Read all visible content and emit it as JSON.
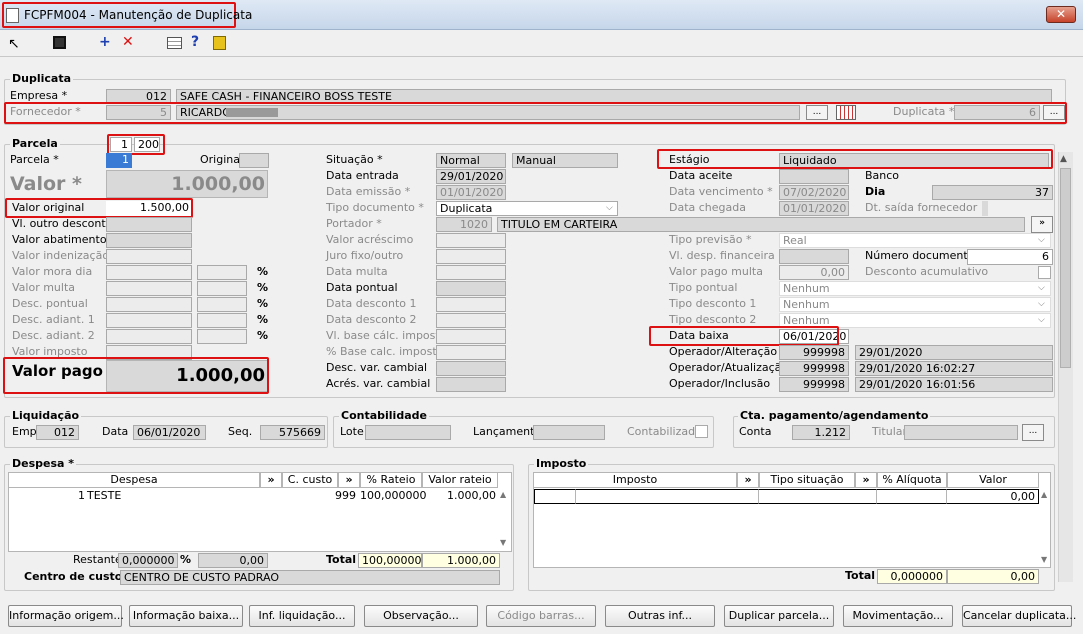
{
  "window": {
    "title": "FCPFM004 - Manutenção de Duplicata"
  },
  "toolbar": {
    "plus": "+",
    "times": "✕",
    "help": "?"
  },
  "duplicata": {
    "section": "Duplicata",
    "empresa_label": "Empresa *",
    "empresa_code": "012",
    "empresa_name": "SAFE CASH - FINANCEIRO BOSS TESTE",
    "fornecedor_label": "Fornecedor *",
    "fornecedor_code": "5",
    "fornecedor_name": "RICARDO",
    "duplicata_label": "Duplicata *",
    "duplicata_value": "6"
  },
  "parcela": {
    "section": "Parcela",
    "num": "1",
    "total": "200",
    "parcela_label": "Parcela *",
    "parcela_value": "1",
    "original_label": "Original",
    "valor_label": "Valor *",
    "valor_value": "1.000,00",
    "fields": [
      {
        "label": "Valor original",
        "value": "1.500,00"
      },
      {
        "label": "Vl. outro desconto",
        "value": ""
      },
      {
        "label": "Valor abatimento",
        "value": ""
      },
      {
        "label": "Valor indenização",
        "value": ""
      },
      {
        "label": "Valor mora dia",
        "value": ""
      },
      {
        "label": "Valor multa",
        "value": ""
      },
      {
        "label": "Desc. pontual",
        "value": ""
      },
      {
        "label": "Desc. adiant. 1",
        "value": ""
      },
      {
        "label": "Desc. adiant. 2",
        "value": ""
      },
      {
        "label": "Valor imposto",
        "value": ""
      }
    ],
    "percent": "%",
    "valor_pago_label": "Valor pago",
    "valor_pago_value": "1.000,00"
  },
  "mid": {
    "situacao_label": "Situação *",
    "situacao_1": "Normal",
    "situacao_2": "Manual",
    "data_entrada_label": "Data entrada",
    "data_entrada": "29/01/2020",
    "data_emissao_label": "Data emissão *",
    "data_emissao": "01/01/2020",
    "tipo_doc_label": "Tipo documento *",
    "tipo_doc": "Duplicata",
    "portador_label": "Portador *",
    "portador_code": "1020",
    "portador_name": "TITULO EM CARTEIRA",
    "labels": [
      "Valor acréscimo",
      "Juro fixo/outro",
      "Data multa",
      "Data pontual",
      "Data desconto 1",
      "Data desconto 2",
      "Vl. base cálc. imposto",
      "% Base calc. imposto",
      "Desc. var. cambial",
      "Acrés. var. cambial"
    ]
  },
  "right": {
    "estagio_label": "Estágio",
    "estagio_value": "Liquidado",
    "data_aceite_label": "Data aceite",
    "banco_label": "Banco",
    "data_vencimento_label": "Data vencimento *",
    "data_vencimento": "07/02/2020",
    "dia_label": "Dia",
    "dia_value": "37",
    "data_chegada_label": "Data chegada",
    "data_chegada": "01/01/2020",
    "dt_saida_label": "Dt. saída fornecedor",
    "tipo_previsao_label": "Tipo previsão *",
    "tipo_previsao": "Real",
    "vl_desp_label": "Vl. desp. financeira",
    "num_doc_label": "Número documento",
    "num_doc": "6",
    "vl_pago_multa_label": "Valor pago multa",
    "vl_pago_multa": "0,00",
    "desc_acum_label": "Desconto acumulativo",
    "tipo_pontual_label": "Tipo pontual",
    "tipo_pontual": "Nenhum",
    "tipo_desc1_label": "Tipo desconto 1",
    "tipo_desc1": "Nenhum",
    "tipo_desc2_label": "Tipo desconto 2",
    "tipo_desc2": "Nenhum",
    "data_baixa_label": "Data baixa",
    "data_baixa": "06/01/2020",
    "operadores": [
      {
        "label": "Operador/Alteração",
        "code": "999998",
        "date": "29/01/2020"
      },
      {
        "label": "Operador/Atualização",
        "code": "999998",
        "date": "29/01/2020 16:02:27"
      },
      {
        "label": "Operador/Inclusão",
        "code": "999998",
        "date": "29/01/2020 16:01:56"
      }
    ]
  },
  "liquidacao": {
    "section": "Liquidação",
    "emp_label": "Emp.",
    "emp": "012",
    "data_label": "Data",
    "data": "06/01/2020",
    "seq_label": "Seq.",
    "seq": "575669"
  },
  "contabilidade": {
    "section": "Contabilidade",
    "lote_label": "Lote",
    "lancamento_label": "Lançamento",
    "contabilizado_label": "Contabilizado"
  },
  "cta": {
    "section": "Cta. pagamento/agendamento",
    "conta_label": "Conta",
    "conta": "1.212",
    "titular_label": "Titular"
  },
  "despesa": {
    "section": "Despesa *",
    "cols": [
      "Despesa",
      "C. custo",
      "% Rateio",
      "Valor rateio"
    ],
    "rows": [
      {
        "num": "1",
        "name": "TESTE",
        "ccusto": "999",
        "rateio": "100,000000",
        "valor": "1.000,00"
      }
    ],
    "restante_label": "Restante",
    "restante_pct": "0,000000",
    "restante_val": "0,00",
    "total_label": "Total",
    "total_pct": "100,000000",
    "total_val": "1.000,00",
    "centro_label": "Centro de custo:",
    "centro_value": "CENTRO DE CUSTO PADRAO"
  },
  "imposto": {
    "section": "Imposto",
    "cols": [
      "Imposto",
      "Tipo situação",
      "% Alíquota",
      "Valor"
    ],
    "row_valor": "0,00",
    "total_label": "Total",
    "total_pct": "0,000000",
    "total_val": "0,00"
  },
  "buttons": [
    "Informação origem...",
    "Informação baixa...",
    "Inf. liquidação...",
    "Observação...",
    "Código barras...",
    "Outras inf...",
    "Duplicar parcela...",
    "Movimentação...",
    "Cancelar duplicata..."
  ],
  "arrow_label": "»",
  "dots_label": "..."
}
